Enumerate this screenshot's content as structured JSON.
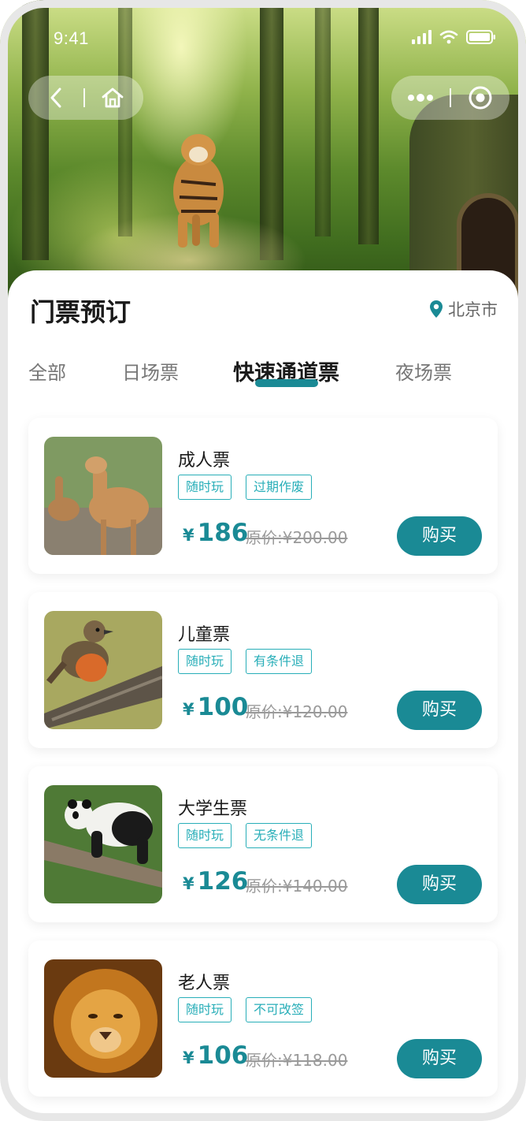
{
  "status_bar": {
    "time": "9:41"
  },
  "page": {
    "title": "门票预订",
    "location": "北京市"
  },
  "tabs": [
    {
      "label": "全部",
      "active": false
    },
    {
      "label": "日场票",
      "active": false
    },
    {
      "label": "快速通道票",
      "active": true
    },
    {
      "label": "夜场票",
      "active": false
    }
  ],
  "colors": {
    "accent": "#1a8a95",
    "tag": "#28aeb8"
  },
  "tickets": [
    {
      "name": "成人票",
      "image": "deer-photo",
      "tags": [
        "随时玩",
        "过期作废"
      ],
      "currency": "¥",
      "price": "186",
      "original": "原价:¥200.00",
      "buy_label": "购买"
    },
    {
      "name": "儿童票",
      "image": "robin-photo",
      "tags": [
        "随时玩",
        "有条件退"
      ],
      "currency": "¥",
      "price": "100",
      "original": "原价:¥120.00",
      "buy_label": "购买"
    },
    {
      "name": "大学生票",
      "image": "panda-photo",
      "tags": [
        "随时玩",
        "无条件退"
      ],
      "currency": "¥",
      "price": "126",
      "original": "原价:¥140.00",
      "buy_label": "购买"
    },
    {
      "name": "老人票",
      "image": "lion-photo",
      "tags": [
        "随时玩",
        "不可改签"
      ],
      "currency": "¥",
      "price": "106",
      "original": "原价:¥118.00",
      "buy_label": "购买"
    }
  ]
}
